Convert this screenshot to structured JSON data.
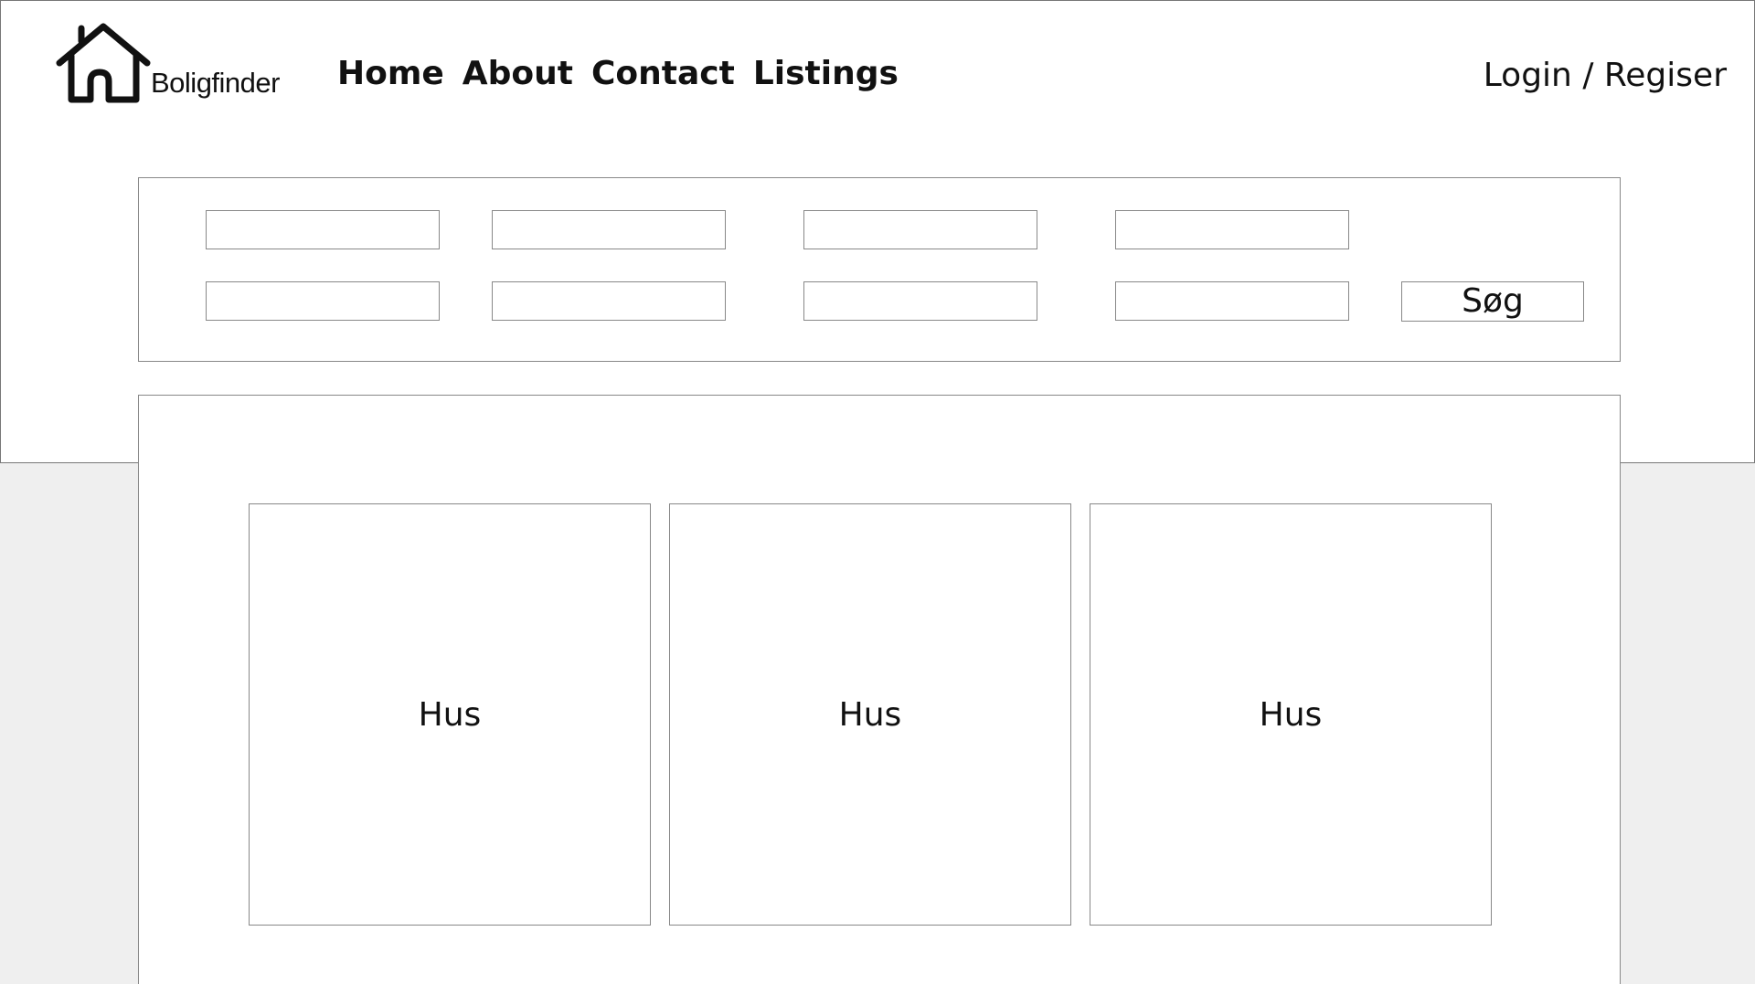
{
  "header": {
    "logo_text": "Boligfinder",
    "logo_icon": "house-icon",
    "nav": [
      "Home",
      "About",
      "Contact",
      "Listings"
    ],
    "login_label": "Login / Regiser"
  },
  "search": {
    "button_label": "Søg",
    "fields": [
      {
        "value": "",
        "placeholder": ""
      },
      {
        "value": "",
        "placeholder": ""
      },
      {
        "value": "",
        "placeholder": ""
      },
      {
        "value": "",
        "placeholder": ""
      },
      {
        "value": "",
        "placeholder": ""
      },
      {
        "value": "",
        "placeholder": ""
      },
      {
        "value": "",
        "placeholder": ""
      },
      {
        "value": "",
        "placeholder": ""
      }
    ]
  },
  "listings": [
    {
      "label": "Hus"
    },
    {
      "label": "Hus"
    },
    {
      "label": "Hus"
    }
  ],
  "colors": {
    "background": "#efefef",
    "panel": "#ffffff",
    "border": "#888888",
    "text": "#111111"
  }
}
